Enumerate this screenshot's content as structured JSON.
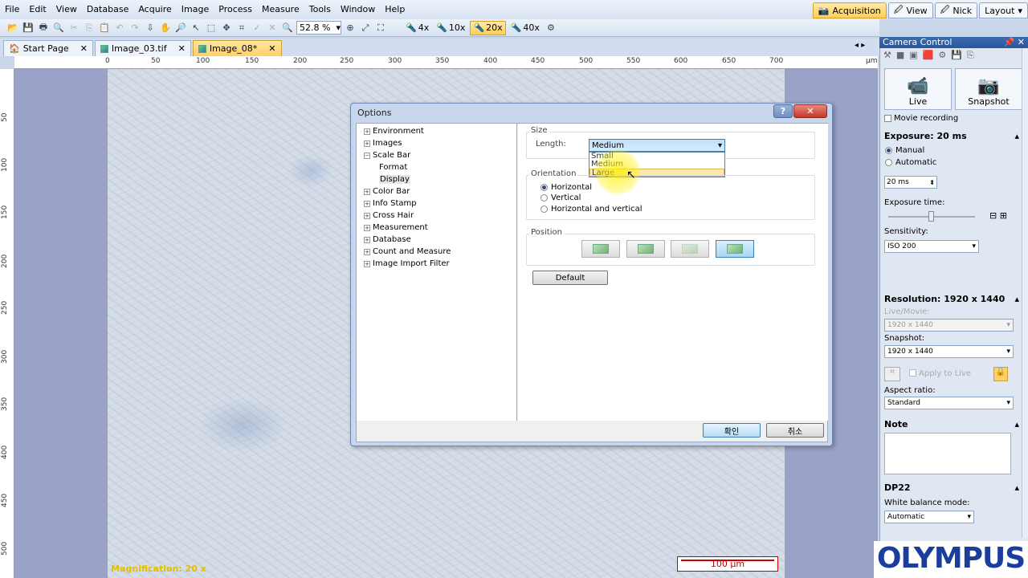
{
  "menu": [
    "File",
    "Edit",
    "View",
    "Database",
    "Acquire",
    "Image",
    "Process",
    "Measure",
    "Tools",
    "Window",
    "Help"
  ],
  "mode_tabs": [
    {
      "label": "Acquisition",
      "active": true
    },
    {
      "label": "View",
      "active": false
    },
    {
      "label": "Nick",
      "active": false
    },
    {
      "label": "Layout",
      "active": false
    }
  ],
  "toolbar": {
    "zoom": "52.8 %",
    "objectives": [
      {
        "label": "4x",
        "selected": false
      },
      {
        "label": "10x",
        "selected": false
      },
      {
        "label": "20x",
        "selected": true
      },
      {
        "label": "40x",
        "selected": false
      }
    ]
  },
  "doc_tabs": [
    {
      "label": "Start Page",
      "active": false
    },
    {
      "label": "Image_03.tif",
      "active": false
    },
    {
      "label": "Image_08*",
      "active": true
    }
  ],
  "ruler": {
    "h": [
      "0",
      "50",
      "100",
      "150",
      "200",
      "250",
      "300",
      "350",
      "400",
      "450",
      "500",
      "550",
      "600",
      "650",
      "700"
    ],
    "unit": "µm",
    "v": [
      "50",
      "100",
      "150",
      "200",
      "250",
      "300",
      "350",
      "400",
      "450",
      "500"
    ]
  },
  "image": {
    "magnification_label": "Magnification:",
    "magnification_value": "20 x",
    "scale_bar": "100 µm"
  },
  "dialog": {
    "title": "Options",
    "help": "?",
    "close": "✕",
    "tree": [
      {
        "label": "Environment",
        "expander": "+",
        "level": 0
      },
      {
        "label": "Images",
        "expander": "+",
        "level": 0
      },
      {
        "label": "Scale Bar",
        "expander": "−",
        "level": 0
      },
      {
        "label": "Format",
        "expander": "",
        "level": 1
      },
      {
        "label": "Display",
        "expander": "",
        "level": 1,
        "selected": true
      },
      {
        "label": "Color Bar",
        "expander": "+",
        "level": 0
      },
      {
        "label": "Info Stamp",
        "expander": "+",
        "level": 0
      },
      {
        "label": "Cross Hair",
        "expander": "+",
        "level": 0
      },
      {
        "label": "Measurement",
        "expander": "+",
        "level": 0
      },
      {
        "label": "Database",
        "expander": "+",
        "level": 0
      },
      {
        "label": "Count and Measure",
        "expander": "+",
        "level": 0
      },
      {
        "label": "Image Import Filter",
        "expander": "+",
        "level": 0
      }
    ],
    "size_group": "Size",
    "length_label": "Length:",
    "length_value": "Medium",
    "length_options": [
      "Small",
      "Medium",
      "Large"
    ],
    "length_hover": "Large",
    "orientation_group": "Orientation",
    "orientations": [
      {
        "label": "Horizontal",
        "checked": true
      },
      {
        "label": "Vertical",
        "checked": false
      },
      {
        "label": "Horizontal and vertical",
        "checked": false
      }
    ],
    "position_group": "Position",
    "default_button": "Default",
    "ok_button": "확인",
    "cancel_button": "취소"
  },
  "camera": {
    "title": "Camera Control",
    "live": "Live",
    "snapshot": "Snapshot",
    "movie_recording": "Movie recording",
    "exposure_header": "Exposure: 20 ms",
    "manual": "Manual",
    "automatic": "Automatic",
    "exposure_value": "20 ms",
    "exposure_time_label": "Exposure time:",
    "sensitivity_label": "Sensitivity:",
    "sensitivity_value": "ISO 200",
    "resolution_header": "Resolution: 1920 x 1440",
    "live_movie_label": "Live/Movie:",
    "live_movie_value": "1920 x 1440",
    "snapshot_label": "Snapshot:",
    "snapshot_value": "1920 x 1440",
    "apply_to_live": "Apply to Live",
    "aspect_label": "Aspect ratio:",
    "aspect_value": "Standard",
    "note_header": "Note",
    "dp22_header": "DP22",
    "white_balance_label": "White balance mode:",
    "white_balance_value": "Automatic"
  },
  "logo": "OLYMPUS"
}
